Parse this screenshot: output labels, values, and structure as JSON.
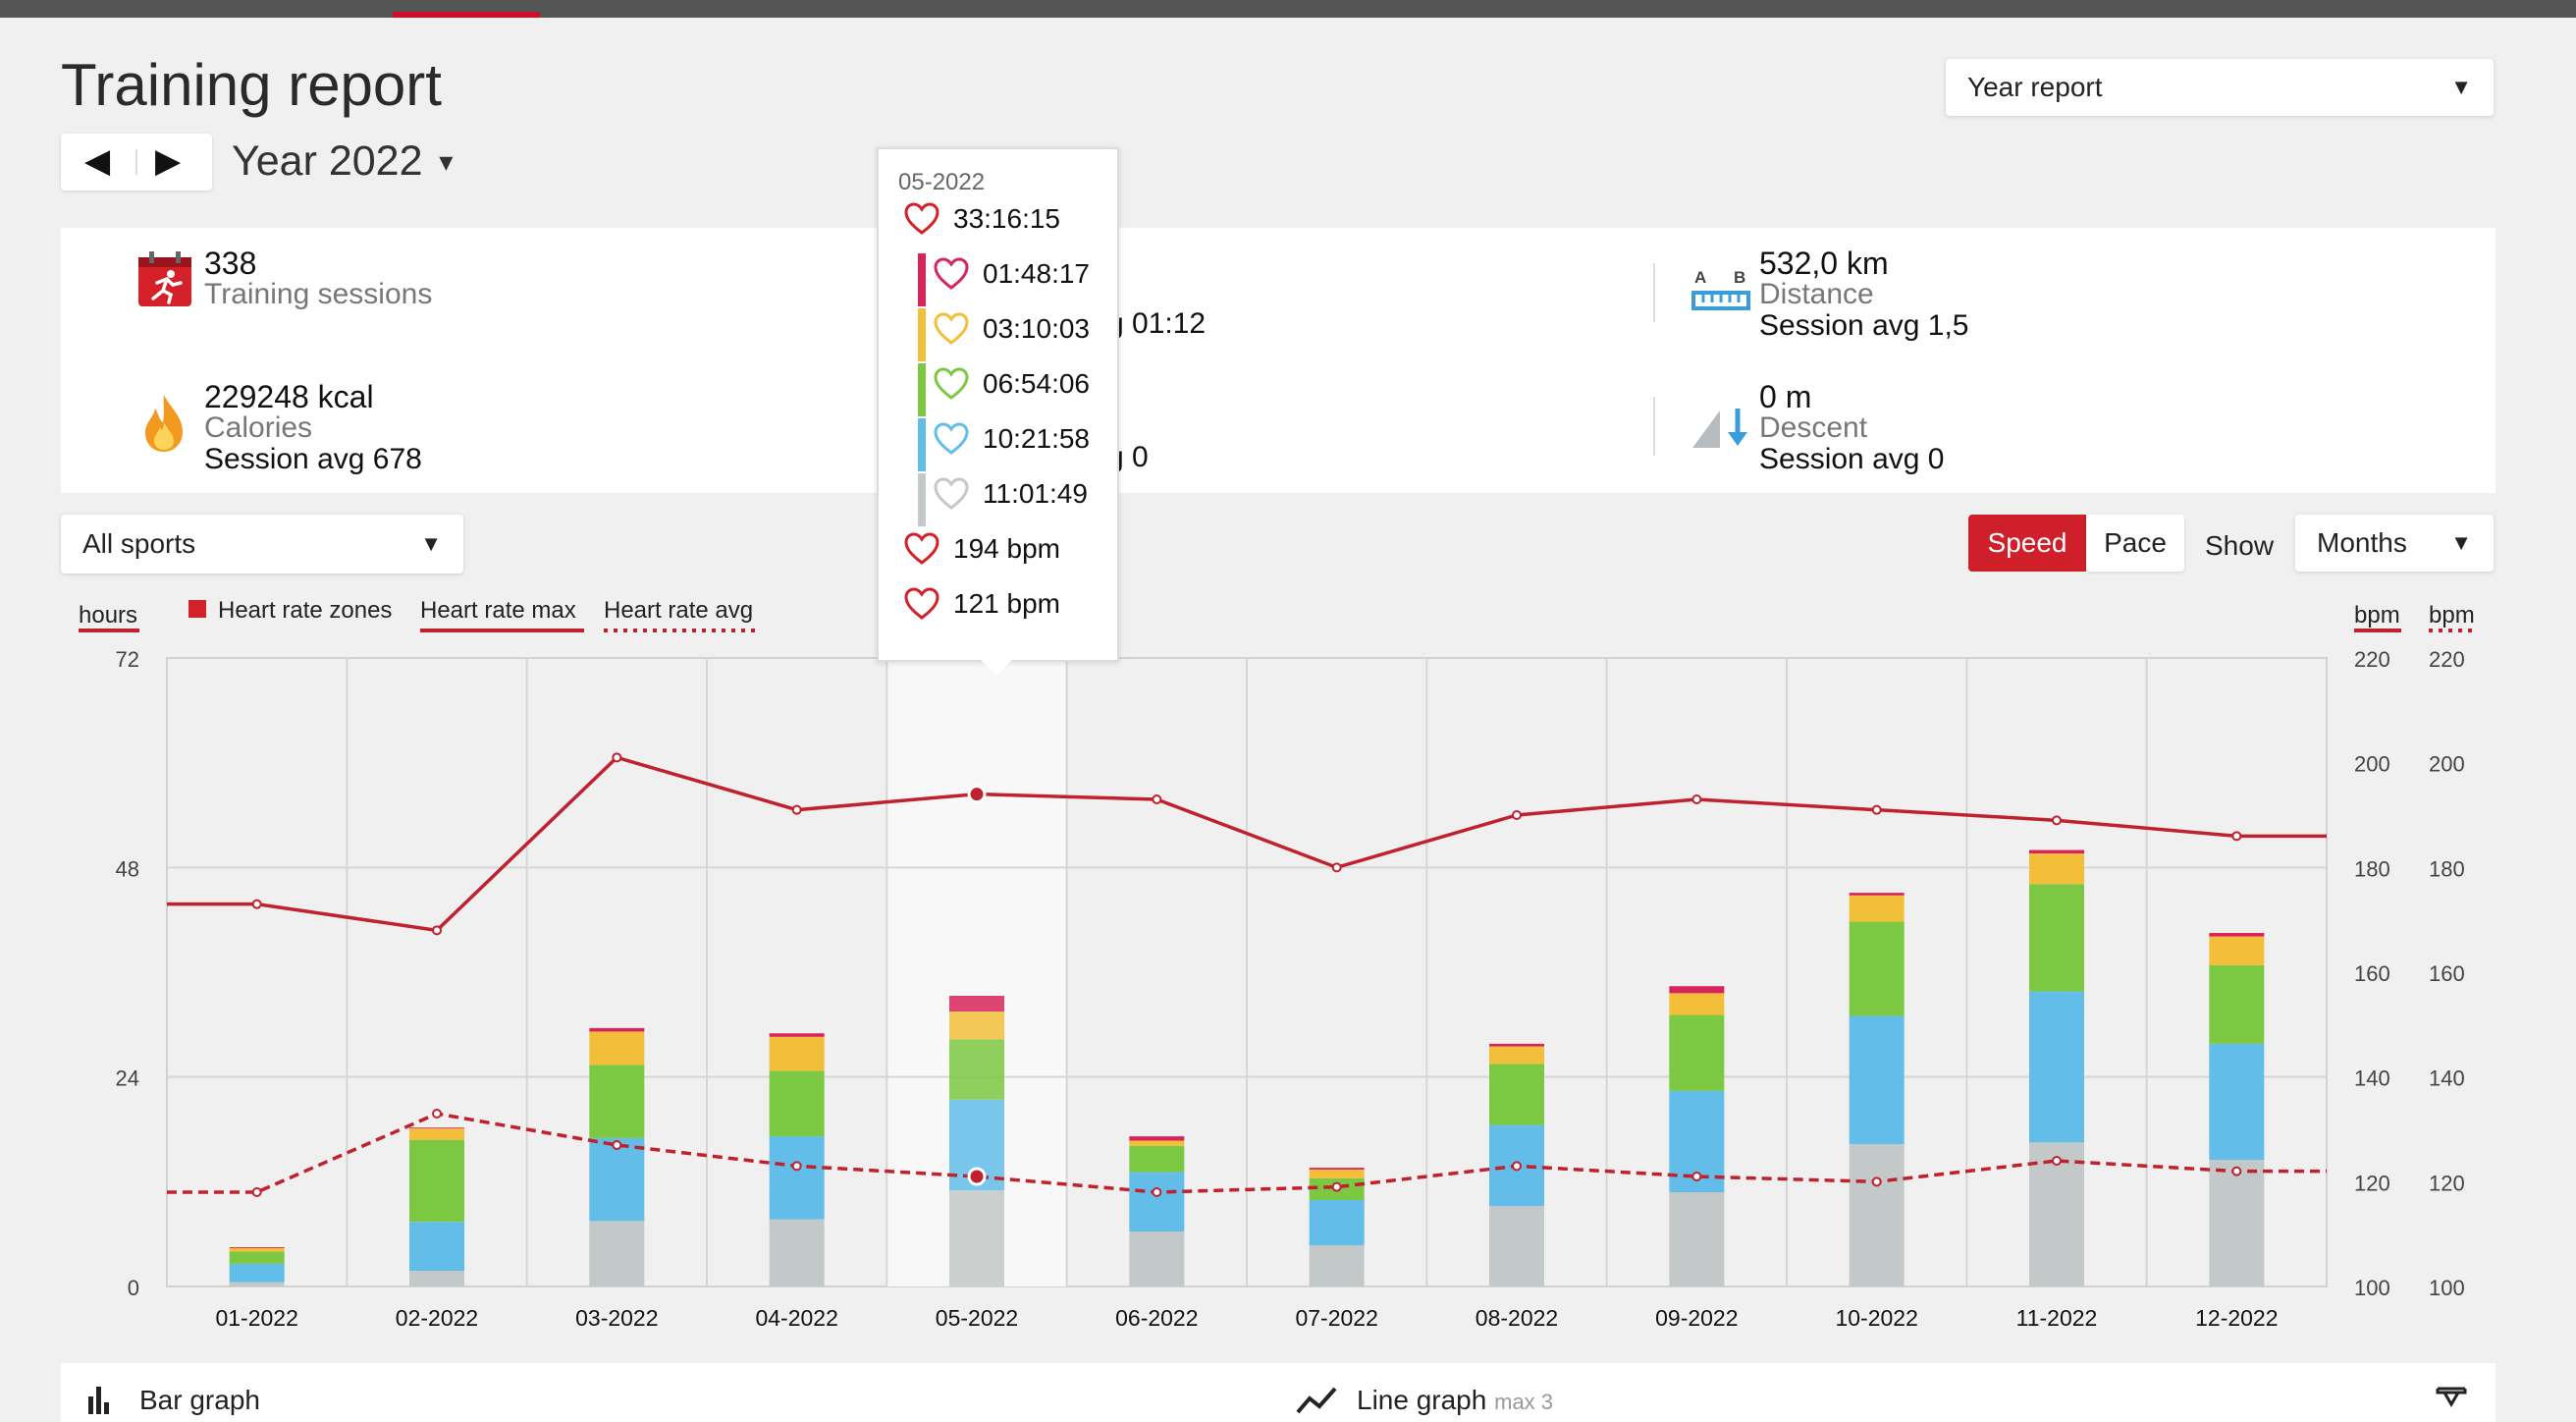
{
  "page": {
    "title": "Training report",
    "year_label": "Year 2022",
    "report_type": "Year report",
    "sport_filter": "All sports",
    "speed_label": "Speed",
    "pace_label": "Pace",
    "show_label": "Show",
    "period_filter": "Months"
  },
  "summary": {
    "sessions_value": "338",
    "sessions_label": "Training sessions",
    "duration_partial": "g 01:12",
    "distance_value": "532,0 km",
    "distance_label": "Distance",
    "distance_avg": "Session avg 1,5",
    "calories_value": "229248 kcal",
    "calories_label": "Calories",
    "calories_avg": "Session avg 678",
    "ascent_partial": "g 0",
    "descent_value": "0 m",
    "descent_label": "Descent",
    "descent_avg": "Session avg 0",
    "distance_icon_a": "A",
    "distance_icon_b": "B"
  },
  "legend": {
    "hours": "hours",
    "zones": "Heart rate zones",
    "hr_max": "Heart rate max",
    "hr_avg": "Heart rate avg",
    "bpm1": "bpm",
    "bpm2": "bpm"
  },
  "tooltip": {
    "date": "05-2022",
    "total": "33:16:15",
    "zones": [
      "01:48:17",
      "03:10:03",
      "06:54:06",
      "10:21:58",
      "11:01:49"
    ],
    "max": "194 bpm",
    "avg": "121 bpm"
  },
  "bottom": {
    "bar_graph": "Bar graph",
    "line_graph": "Line graph",
    "line_max": "max 3"
  },
  "colors": {
    "accent": "#cf1f2a",
    "zone5": "#d8245a",
    "zone4": "#f3bf3a",
    "zone3": "#7dc843",
    "zone2": "#62bde9",
    "zone1": "#c3c9c8",
    "hr_line": "#c0212e"
  },
  "chart_data": {
    "type": "bar",
    "categories": [
      "01-2022",
      "02-2022",
      "03-2022",
      "04-2022",
      "05-2022",
      "06-2022",
      "07-2022",
      "08-2022",
      "09-2022",
      "10-2022",
      "11-2022",
      "12-2022"
    ],
    "ylabel": "hours",
    "ylim": [
      0,
      72
    ],
    "y_ticks": [
      0,
      24,
      48,
      72
    ],
    "y2_label": "bpm",
    "y2lim": [
      100,
      220
    ],
    "y2_ticks": [
      100,
      120,
      140,
      160,
      180,
      200,
      220
    ],
    "series": [
      {
        "name": "Heart rate zones",
        "stack": "zones",
        "zone": 1,
        "values": [
          0.5,
          1.8,
          7.5,
          7.7,
          11.0,
          6.3,
          4.7,
          9.2,
          10.8,
          16.3,
          16.5,
          14.5
        ]
      },
      {
        "name": "Heart rate zones",
        "stack": "zones",
        "zone": 2,
        "values": [
          2.1,
          5.6,
          9.5,
          9.5,
          10.4,
          6.8,
          5.2,
          9.3,
          11.6,
          14.7,
          17.3,
          13.3
        ]
      },
      {
        "name": "Heart rate zones",
        "stack": "zones",
        "zone": 3,
        "values": [
          1.4,
          9.4,
          8.4,
          7.5,
          6.9,
          3.0,
          2.5,
          7.0,
          8.7,
          10.8,
          12.3,
          9.0
        ]
      },
      {
        "name": "Heart rate zones",
        "stack": "zones",
        "zone": 4,
        "values": [
          0.4,
          1.3,
          3.8,
          3.9,
          3.2,
          0.6,
          1.0,
          2.0,
          2.5,
          3.0,
          3.5,
          3.3
        ]
      },
      {
        "name": "Heart rate zones",
        "stack": "zones",
        "zone": 5,
        "values": [
          0.1,
          0.1,
          0.4,
          0.4,
          1.8,
          0.5,
          0.2,
          0.3,
          0.8,
          0.3,
          0.4,
          0.4
        ]
      },
      {
        "name": "Heart rate max",
        "type": "line",
        "axis": "bpm",
        "values": [
          173,
          168,
          201,
          191,
          194,
          193,
          180,
          190,
          193,
          191,
          189,
          186
        ]
      },
      {
        "name": "Heart rate avg",
        "type": "line",
        "style": "dashed",
        "axis": "bpm",
        "values": [
          118,
          133,
          127,
          123,
          121,
          118,
          119,
          123,
          121,
          120,
          124,
          122
        ]
      }
    ]
  }
}
